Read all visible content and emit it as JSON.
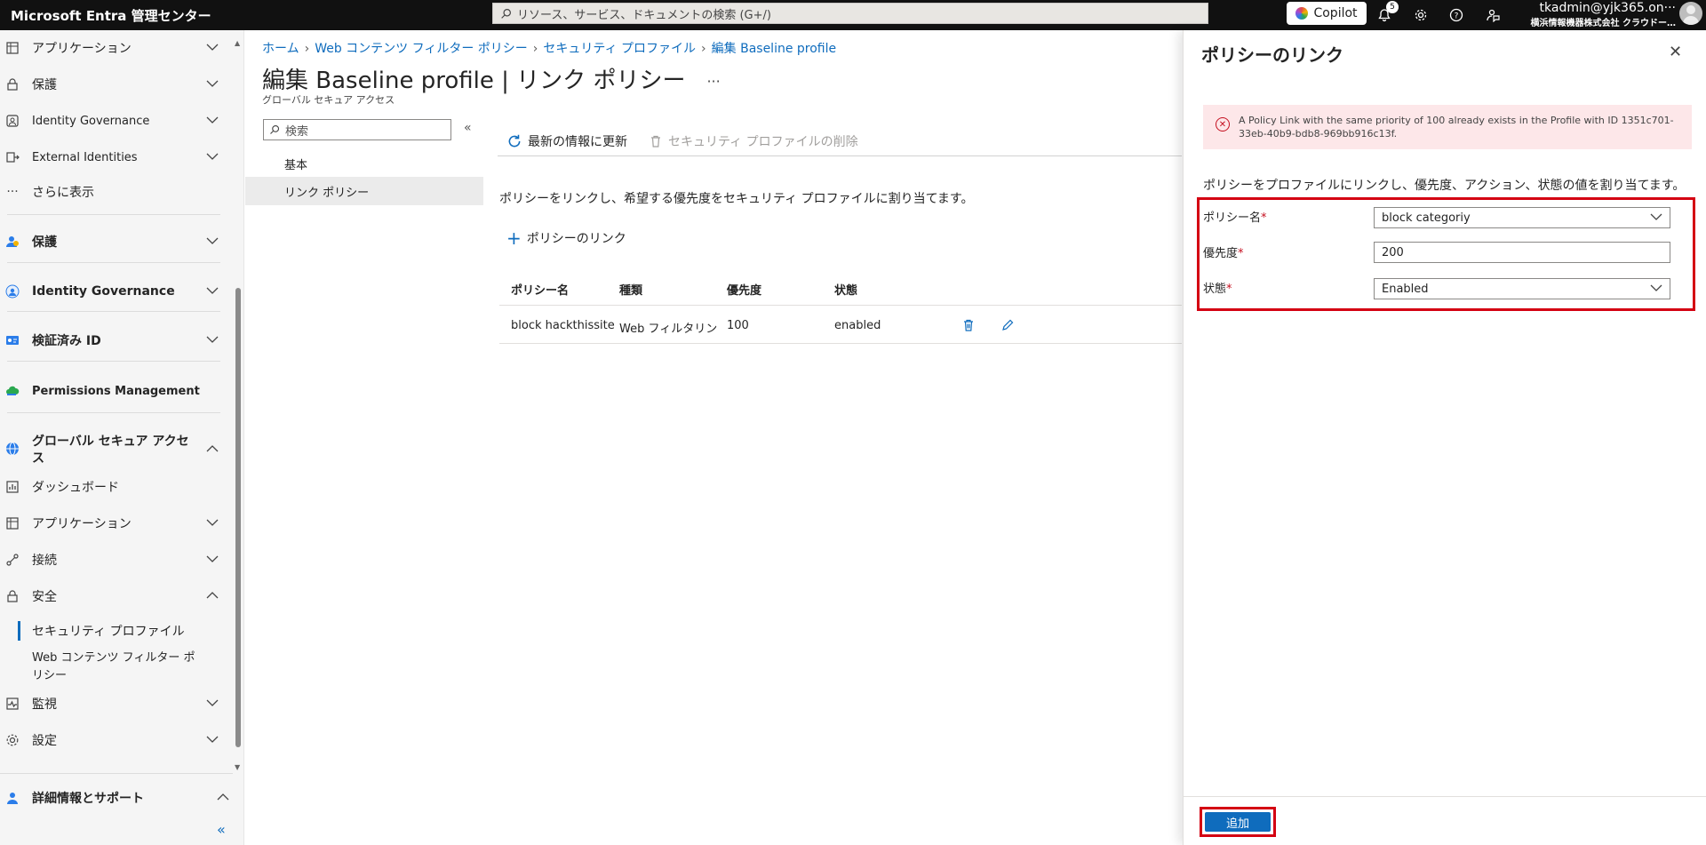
{
  "topbar": {
    "brand": "Microsoft Entra 管理センター",
    "search_placeholder": "リソース、サービス、ドキュメントの検索 (G+/)",
    "copilot_label": "Copilot",
    "notification_count": "5",
    "account_name": "tkadmin@yjk365.on···",
    "account_org": "横浜情報機器株式会社 クラウドー…"
  },
  "sidebar": {
    "items": [
      {
        "label": "アプリケーション",
        "icon": "grid-icon"
      },
      {
        "label": "保護",
        "icon": "lock-icon"
      },
      {
        "label": "Identity Governance",
        "icon": "governance-icon"
      },
      {
        "label": "External Identities",
        "icon": "external-identities-icon"
      },
      {
        "label": "さらに表示",
        "icon": "more-icon"
      },
      {
        "label": "保護",
        "icon": "protect-icon"
      },
      {
        "label": "Identity Governance",
        "icon": "governance-icon"
      },
      {
        "label": "検証済み ID",
        "icon": "verified-id-icon"
      },
      {
        "label": "Permissions Management",
        "icon": "cloud-icon"
      },
      {
        "label": "グローバル セキュア アクセス",
        "icon": "globe-icon"
      },
      {
        "label": "ダッシュボード",
        "icon": "dashboard-icon"
      },
      {
        "label": "アプリケーション",
        "icon": "grid-icon"
      },
      {
        "label": "接続",
        "icon": "connect-icon"
      },
      {
        "label": "安全",
        "icon": "lock-icon"
      },
      {
        "label": "セキュリティ プロファイル",
        "icon": ""
      },
      {
        "label": "Web コンテンツ フィルター ポリシー",
        "icon": ""
      },
      {
        "label": "監視",
        "icon": "monitor-icon"
      },
      {
        "label": "設定",
        "icon": "gear-icon"
      },
      {
        "label": "詳細情報とサポート",
        "icon": "support-icon"
      }
    ],
    "collapse_label": "«"
  },
  "main": {
    "breadcrumb": [
      "ホーム",
      "Web コンテンツ フィルター ポリシー",
      "セキュリティ プロファイル",
      "編集 Baseline profile"
    ],
    "title": "編集 Baseline profile | リンク ポリシー",
    "more_label": "···",
    "subtitle": "グローバル セキュア アクセス",
    "left_search_placeholder": "検索",
    "left_collapse_label": "«",
    "subnav": [
      "基本",
      "リンク ポリシー"
    ],
    "toolbar": {
      "refresh_label": "最新の情報に更新",
      "delete_label": "セキュリティ プロファイルの削除"
    },
    "description": "ポリシーをリンクし、希望する優先度をセキュリティ プロファイルに割り当てます。",
    "link_policy_label": "ポリシーのリンク",
    "table": {
      "headers": [
        "ポリシー名",
        "種類",
        "優先度",
        "状態"
      ],
      "rows": [
        {
          "name": "block hackthissite",
          "type": "Web フィルタリン",
          "priority": "100",
          "state": "enabled"
        }
      ]
    }
  },
  "panel": {
    "title": "ポリシーのリンク",
    "close_label": "✕",
    "error_message": "A Policy Link with the same priority of 100 already exists in the Profile with ID 1351c701-33eb-40b9-bdb8-969bb916c13f.",
    "description": "ポリシーをプロファイルにリンクし、優先度、アクション、状態の値を割り当てます。",
    "fields": {
      "policy_name_label": "ポリシー名",
      "policy_name_value": "block categoriy",
      "priority_label": "優先度",
      "priority_value": "200",
      "state_label": "状態",
      "state_value": "Enabled"
    },
    "required_marker": "*",
    "add_label": "追加"
  },
  "colors": {
    "accent": "#0f6cbd",
    "highlight": "#d40012",
    "error_bg": "#fde7e9",
    "topbar_bg": "#111111"
  }
}
